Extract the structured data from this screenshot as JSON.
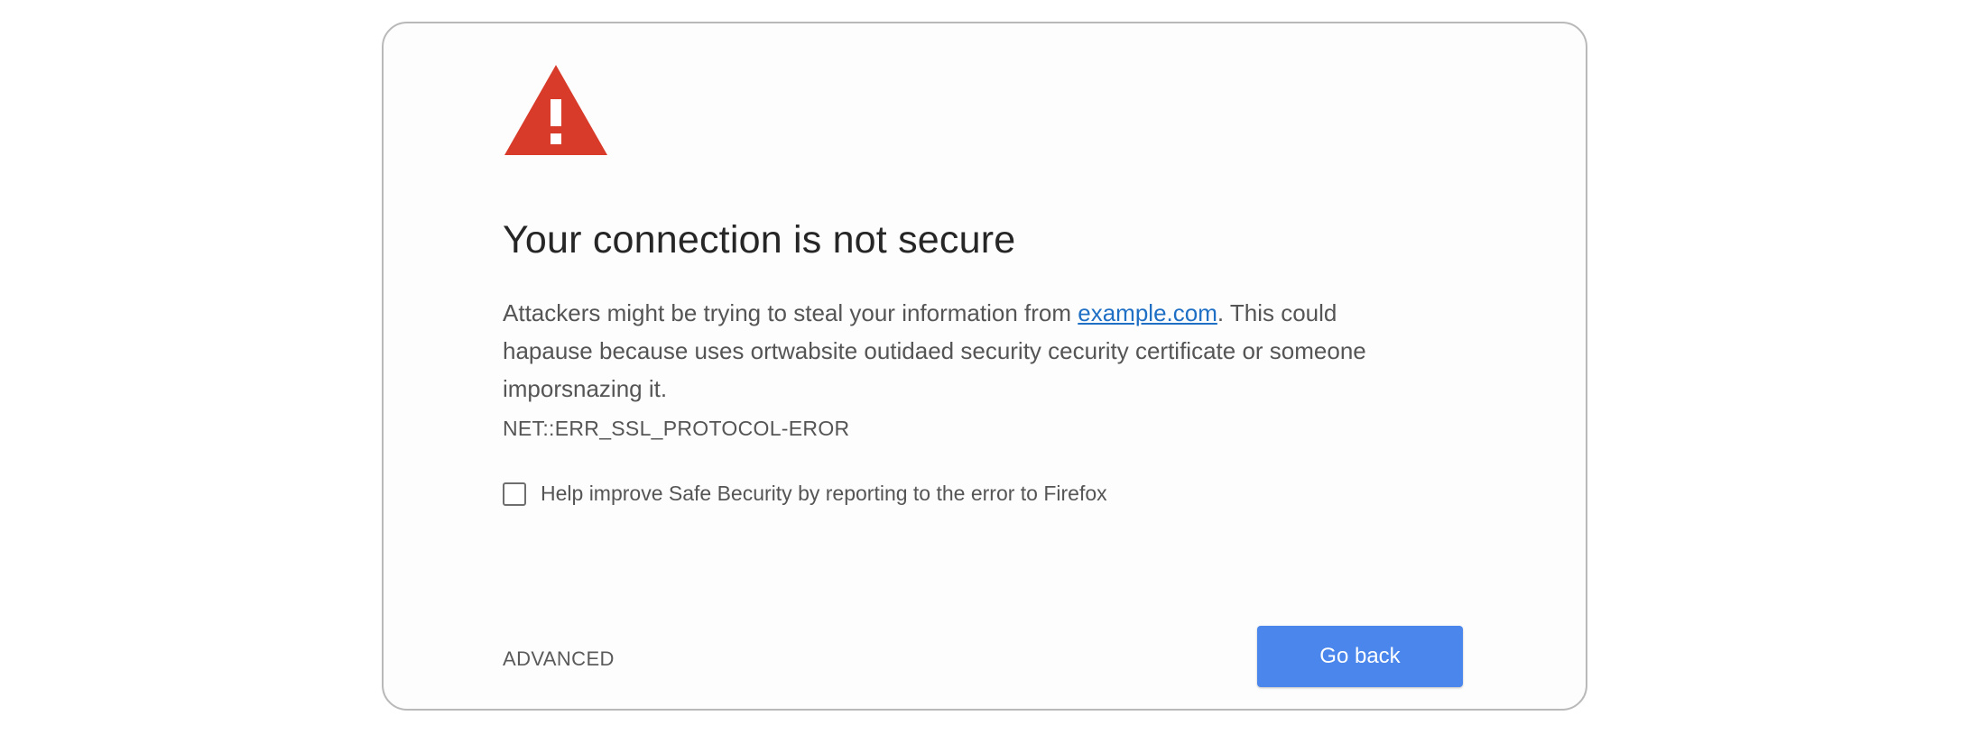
{
  "colors": {
    "warning_red": "#d93b2b",
    "link_blue": "#1f6fc5",
    "button_blue": "#4a86eb"
  },
  "icons": {
    "warning": "warning-triangle-icon"
  },
  "error_page": {
    "title": "Your connection is not secure",
    "description_before_link": "Attackers might be trying to steal your information from ",
    "link_text": "example.com",
    "description_after_link": ". This could hapause because uses ortwabsite outidaed security cecurity certificate or someone imporsnazing it.",
    "error_code": "NET::ERR_SSL_PROTOCOL-EROR",
    "report_checkbox": {
      "label": "Help improve Safe Becurity by reporting to the error to Firefox",
      "checked": false
    },
    "advanced_label": "ADVANCED",
    "go_back_label": "Go back"
  }
}
